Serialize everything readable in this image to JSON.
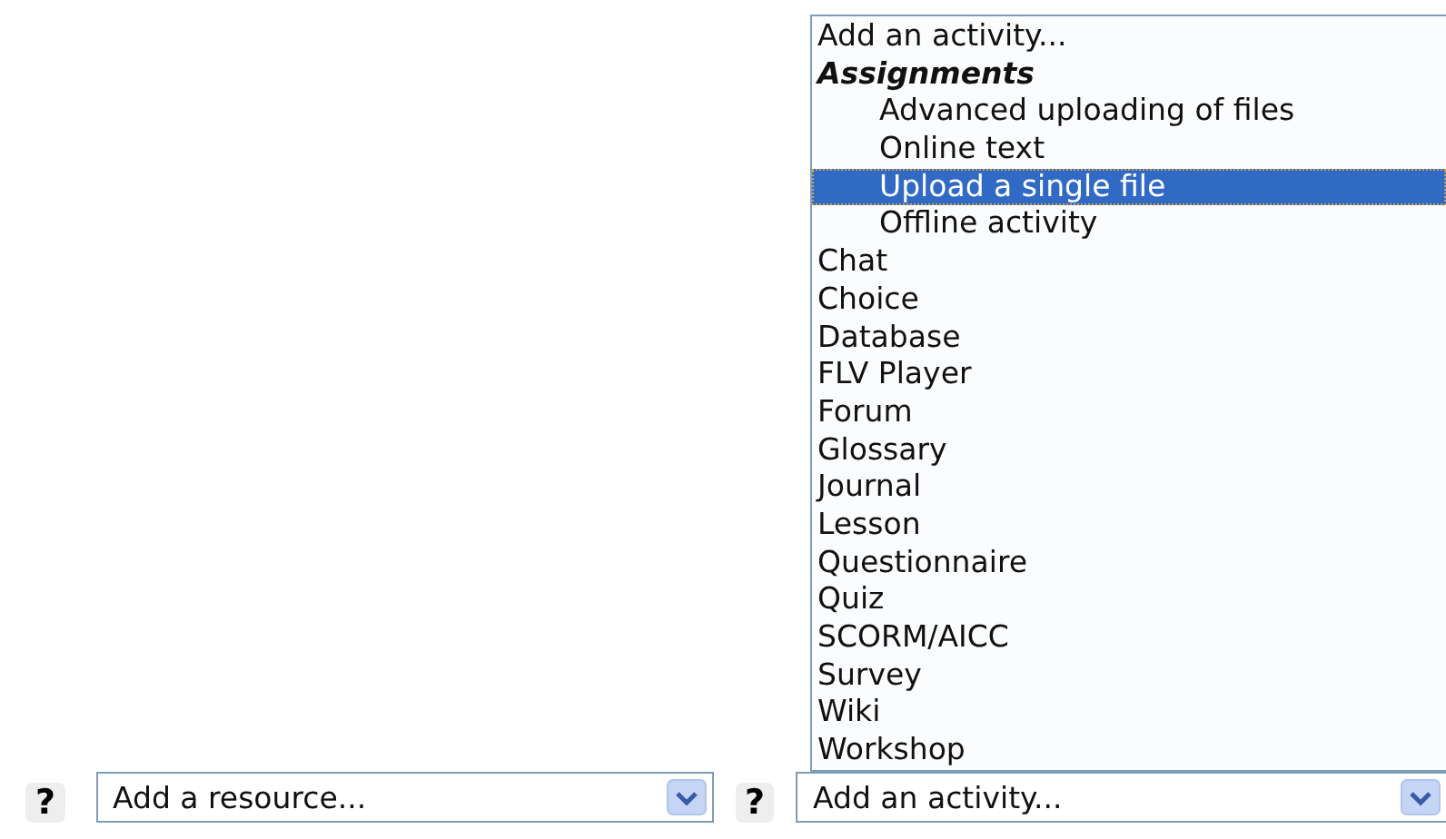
{
  "activity_dropdown_list": {
    "items": [
      {
        "kind": "option",
        "label": "Add an activity...",
        "selected": false
      },
      {
        "kind": "group",
        "label": "Assignments",
        "children": [
          {
            "kind": "option",
            "label": "Advanced uploading of files",
            "selected": false
          },
          {
            "kind": "option",
            "label": "Online text",
            "selected": false
          },
          {
            "kind": "option",
            "label": "Upload a single file",
            "selected": true
          },
          {
            "kind": "option",
            "label": "Offline activity",
            "selected": false
          }
        ]
      },
      {
        "kind": "option",
        "label": "Chat",
        "selected": false
      },
      {
        "kind": "option",
        "label": "Choice",
        "selected": false
      },
      {
        "kind": "option",
        "label": "Database",
        "selected": false
      },
      {
        "kind": "option",
        "label": "FLV Player",
        "selected": false
      },
      {
        "kind": "option",
        "label": "Forum",
        "selected": false
      },
      {
        "kind": "option",
        "label": "Glossary",
        "selected": false
      },
      {
        "kind": "option",
        "label": "Journal",
        "selected": false
      },
      {
        "kind": "option",
        "label": "Lesson",
        "selected": false
      },
      {
        "kind": "option",
        "label": "Questionnaire",
        "selected": false
      },
      {
        "kind": "option",
        "label": "Quiz",
        "selected": false
      },
      {
        "kind": "option",
        "label": "SCORM/AICC",
        "selected": false
      },
      {
        "kind": "option",
        "label": "Survey",
        "selected": false
      },
      {
        "kind": "option",
        "label": "Wiki",
        "selected": false
      },
      {
        "kind": "option",
        "label": "Workshop",
        "selected": false
      }
    ]
  },
  "controls": [
    {
      "help": "?",
      "select": {
        "value": "Add a resource..."
      }
    },
    {
      "help": "?",
      "select": {
        "value": "Add an activity..."
      }
    }
  ]
}
